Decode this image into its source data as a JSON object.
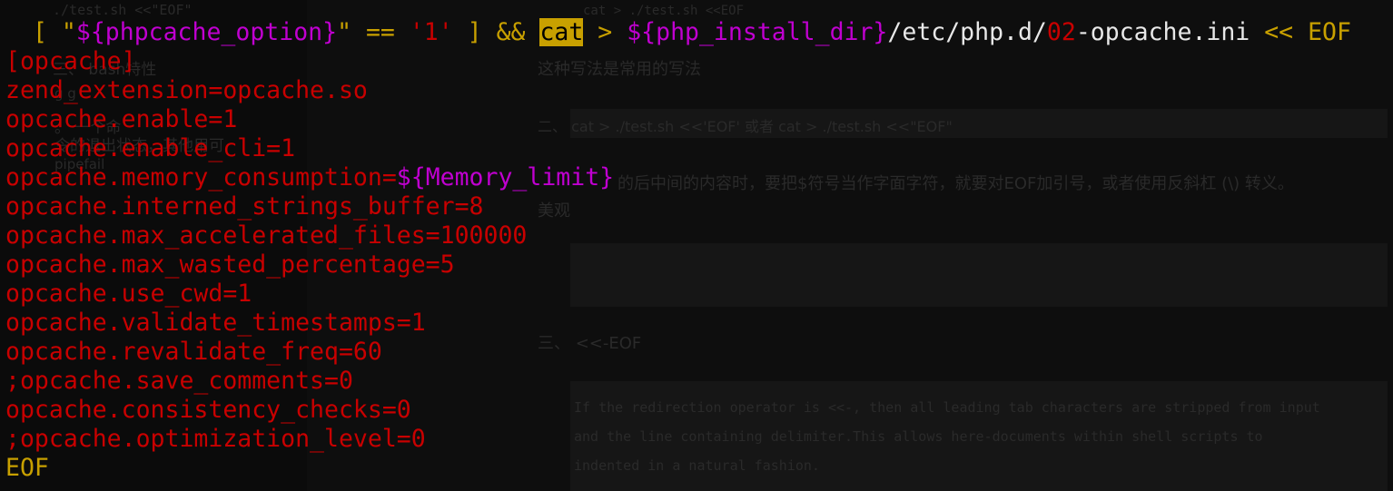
{
  "background": {
    "left_lines": [
      {
        "text": "./test.sh <<\"EOF\""
      },
      {
        "text": "三、   bash特性"
      },
      {
        "text": "g   g"
      },
      {
        "text": "。             一个命"
      },
      {
        "text": "令的退出状态，其他用可"
      },
      {
        "text": "pipefail"
      }
    ],
    "right_lines": [
      {
        "text": "cat > ./test.sh <<EOF"
      },
      {
        "text": "这种写法是常用的写法"
      },
      {
        "text": "二、 cat > ./test.sh <<'EOF' 或者 cat > ./test.sh <<\"EOF\""
      },
      {
        "text": "的后中间的内容时，要把$符号当作字面字符，就要对EOF加引号，或者使用反斜杠 (\\) 转义。"
      },
      {
        "text": "美观"
      },
      {
        "text": "三、 <<-EOF"
      },
      {
        "text": "If the redirection operator is <<-, then all leading tab characters are stripped from input"
      },
      {
        "text": "and the line containing delimiter.This allows here-documents within shell scripts to"
      },
      {
        "text": "indented in a natural fashion."
      }
    ]
  },
  "terminal": {
    "colors": {
      "keyword": "#c8a000",
      "variable": "#c000d0",
      "body": "#c80000",
      "plain": "#e8e8e8"
    },
    "header": {
      "open_bracket": "[ \"",
      "var1": "${phpcache_option}",
      "quote_eq": "\" == ",
      "one": "'1'",
      "close_and": " ] && ",
      "cat": "cat",
      "gt": " > ",
      "var2": "${php_install_dir}",
      "path_a": "/etc/php.d/",
      "num": "02",
      "path_b": "-opcache.ini",
      "heredoc": " << EOF"
    },
    "section": "[opcache]",
    "lines": [
      "zend_extension=opcache.so",
      "opcache.enable=1",
      "opcache.enable_cli=1"
    ],
    "memory_prefix": "opcache.memory_consumption=",
    "memory_var": "${Memory_limit}",
    "lines2": [
      "opcache.interned_strings_buffer=8",
      "opcache.max_accelerated_files=100000",
      "opcache.max_wasted_percentage=5",
      "opcache.use_cwd=1",
      "opcache.validate_timestamps=1",
      "opcache.revalidate_freq=60",
      ";opcache.save_comments=0",
      "opcache.consistency_checks=0",
      ";opcache.optimization_level=0"
    ],
    "eof": "EOF"
  }
}
